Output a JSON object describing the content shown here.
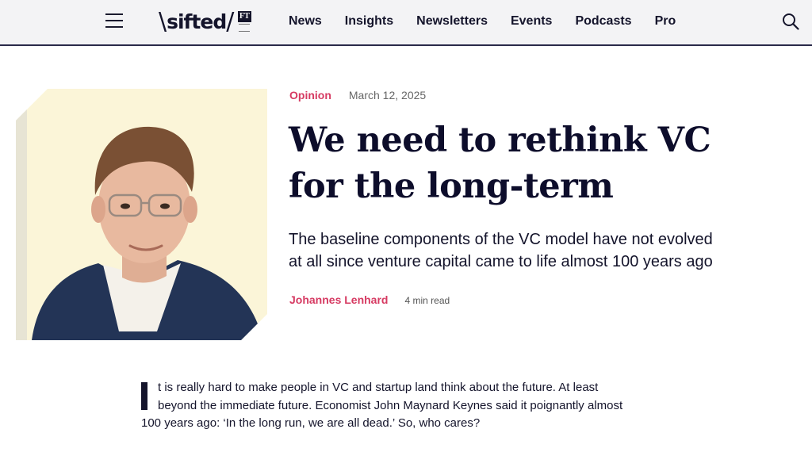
{
  "header": {
    "logo_text": "sifted",
    "ft_badge": "FT",
    "nav": [
      "News",
      "Insights",
      "Newsletters",
      "Events",
      "Podcasts",
      "Pro"
    ]
  },
  "article": {
    "category": "Opinion",
    "date": "March 12, 2025",
    "title_lines": [
      "We need to rethink VC",
      "for the long-term"
    ],
    "subtitle_lines": [
      "The baseline components of the VC model have not evolved",
      "at all since venture capital came to life almost 100 years ago"
    ],
    "author": "Johannes Lenhard",
    "read_time": "4 min read",
    "body_lines": [
      "t is really hard to make people in VC and startup land think about the future. At least",
      "beyond the immediate future. Economist John Maynard Keynes said it poignantly almost",
      "100 years ago: ‘In the long run, we are all dead.’ So, who cares?"
    ]
  },
  "icons": {
    "menu": "hamburger-menu-icon",
    "search": "search-icon"
  },
  "colors": {
    "accent": "#d63a62",
    "navy": "#14142b",
    "header_bg": "#f3f3f5",
    "photo_bg": "#fbf5d8"
  }
}
